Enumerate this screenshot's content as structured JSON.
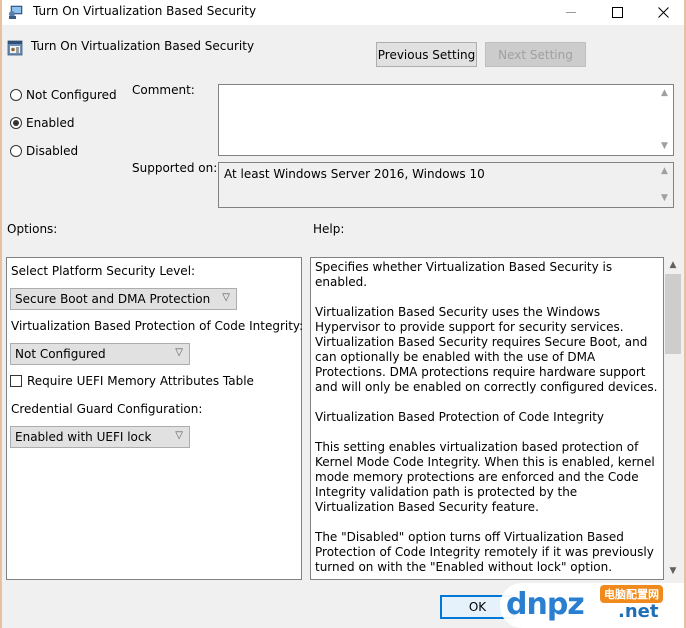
{
  "window": {
    "title": "Turn On Virtualization Based Security",
    "controls": {
      "minimize": "—",
      "maximize": "☐",
      "close": "✕"
    }
  },
  "header": {
    "title": "Turn On Virtualization Based Security",
    "icon": "policy-setting-icon",
    "previous_label": "Previous Setting",
    "next_label": "Next Setting"
  },
  "state": {
    "options": [
      {
        "label": "Not Configured",
        "checked": false
      },
      {
        "label": "Enabled",
        "checked": true
      },
      {
        "label": "Disabled",
        "checked": false
      }
    ]
  },
  "comment": {
    "label": "Comment:",
    "value": ""
  },
  "supported": {
    "label": "Supported on:",
    "value": "At least Windows Server 2016, Windows 10"
  },
  "options_panel": {
    "label": "Options:",
    "platform_label": "Select Platform Security Level:",
    "platform_value": "Secure Boot and DMA Protection",
    "code_integrity_label": "Virtualization Based Protection of Code Integrity:",
    "code_integrity_value": "Not Configured",
    "uefi_checkbox_label": "Require UEFI Memory Attributes Table",
    "uefi_checked": false,
    "credential_guard_label": "Credential Guard Configuration:",
    "credential_guard_value": "Enabled with UEFI lock"
  },
  "help": {
    "label": "Help:",
    "paragraphs": [
      "Specifies whether Virtualization Based Security is enabled.",
      "Virtualization Based Security uses the Windows Hypervisor to provide support for security services. Virtualization Based Security requires Secure Boot, and can optionally be enabled with the use of DMA Protections. DMA protections require hardware support and will only be enabled on correctly configured devices.",
      "Virtualization Based Protection of Code Integrity",
      "This setting enables virtualization based protection of Kernel Mode Code Integrity. When this is enabled, kernel mode memory protections are enforced and the Code Integrity validation path is protected by the Virtualization Based Security feature.",
      "The \"Disabled\" option turns off Virtualization Based Protection of Code Integrity remotely if it was previously turned on with the \"Enabled without lock\" option."
    ]
  },
  "footer": {
    "ok_label": "OK"
  },
  "watermark": {
    "brand": "dnpz",
    "tld": ".net",
    "badge": "电脑配置网"
  },
  "colors": {
    "accent": "#0078d7",
    "watermark_blue": "#2a7fd0",
    "watermark_orange": "#f08a1c"
  }
}
